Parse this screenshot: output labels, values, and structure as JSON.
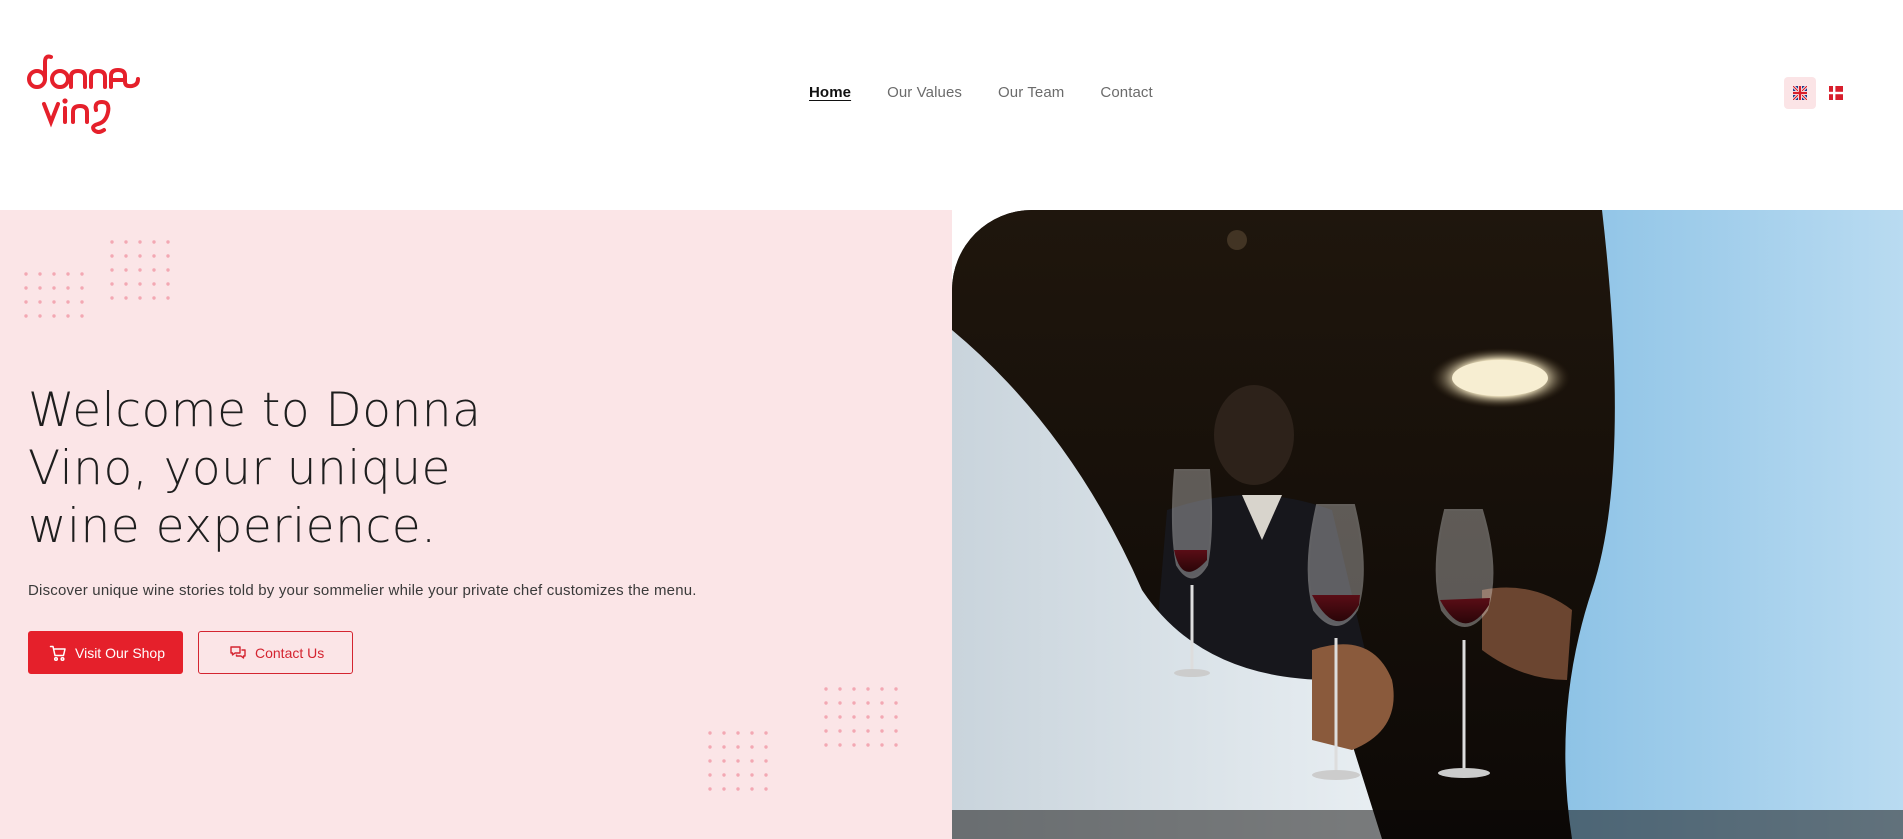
{
  "brand": {
    "logo_line1": "donna",
    "logo_line2": "vino",
    "logo_color": "#e5202b"
  },
  "nav": {
    "items": [
      {
        "label": "Home",
        "active": true
      },
      {
        "label": "Our Values",
        "active": false
      },
      {
        "label": "Our Team",
        "active": false
      },
      {
        "label": "Contact",
        "active": false
      }
    ]
  },
  "language": {
    "options": [
      {
        "name": "uk-flag-icon",
        "active": true
      },
      {
        "name": "danish-flag-icon",
        "active": false
      }
    ]
  },
  "hero": {
    "title": "Welcome to Donna Vino, your unique wine experience.",
    "subtitle": "Discover unique wine stories told by your sommelier while your private chef customizes the menu.",
    "primary_button": {
      "label": "Visit Our Shop",
      "icon": "cart-icon"
    },
    "secondary_button": {
      "label": "Contact Us",
      "icon": "chat-icon"
    },
    "image": "wine-toast-photo"
  },
  "colors": {
    "accent": "#e5202b",
    "hero_bg": "#fbe5e7",
    "dots": "#f3a8b3"
  }
}
